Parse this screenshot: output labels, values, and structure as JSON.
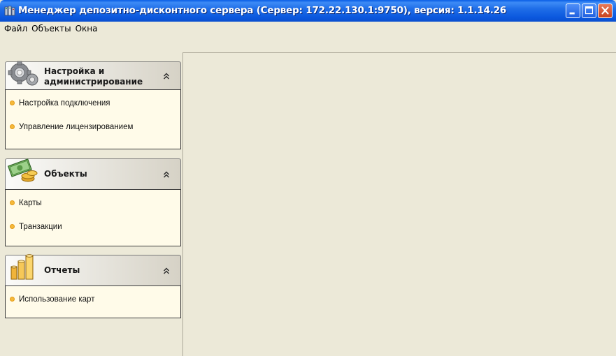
{
  "window": {
    "title": "Менеджер депозитно-дисконтного сервера (Сервер: 172.22.130.1:9750), версия: 1.1.14.26",
    "app_icon": "server-app-icon",
    "controls": {
      "minimize_icon": "minimize-icon",
      "maximize_icon": "maximize-icon",
      "close_icon": "close-icon"
    }
  },
  "menu": {
    "items": [
      "Файл",
      "Объекты",
      "Окна"
    ]
  },
  "sidebar": {
    "groups": [
      {
        "icon": "gears-icon",
        "title_line1": "Настройка и",
        "title_line2": "администрирование",
        "items": [
          "Настройка подключения",
          "Управление лицензированием"
        ]
      },
      {
        "icon": "money-coins-icon",
        "title_line1": "Объекты",
        "items": [
          "Карты",
          "Транзакции"
        ]
      },
      {
        "icon": "reports-chart-icon",
        "title_line1": "Отчеты",
        "items": [
          "Использование карт"
        ]
      }
    ]
  },
  "colors": {
    "titlebar": "#0b58de",
    "panel_bg": "#fffbe9",
    "window_bg": "#ece9d8",
    "bullet": "#f5b93b"
  }
}
